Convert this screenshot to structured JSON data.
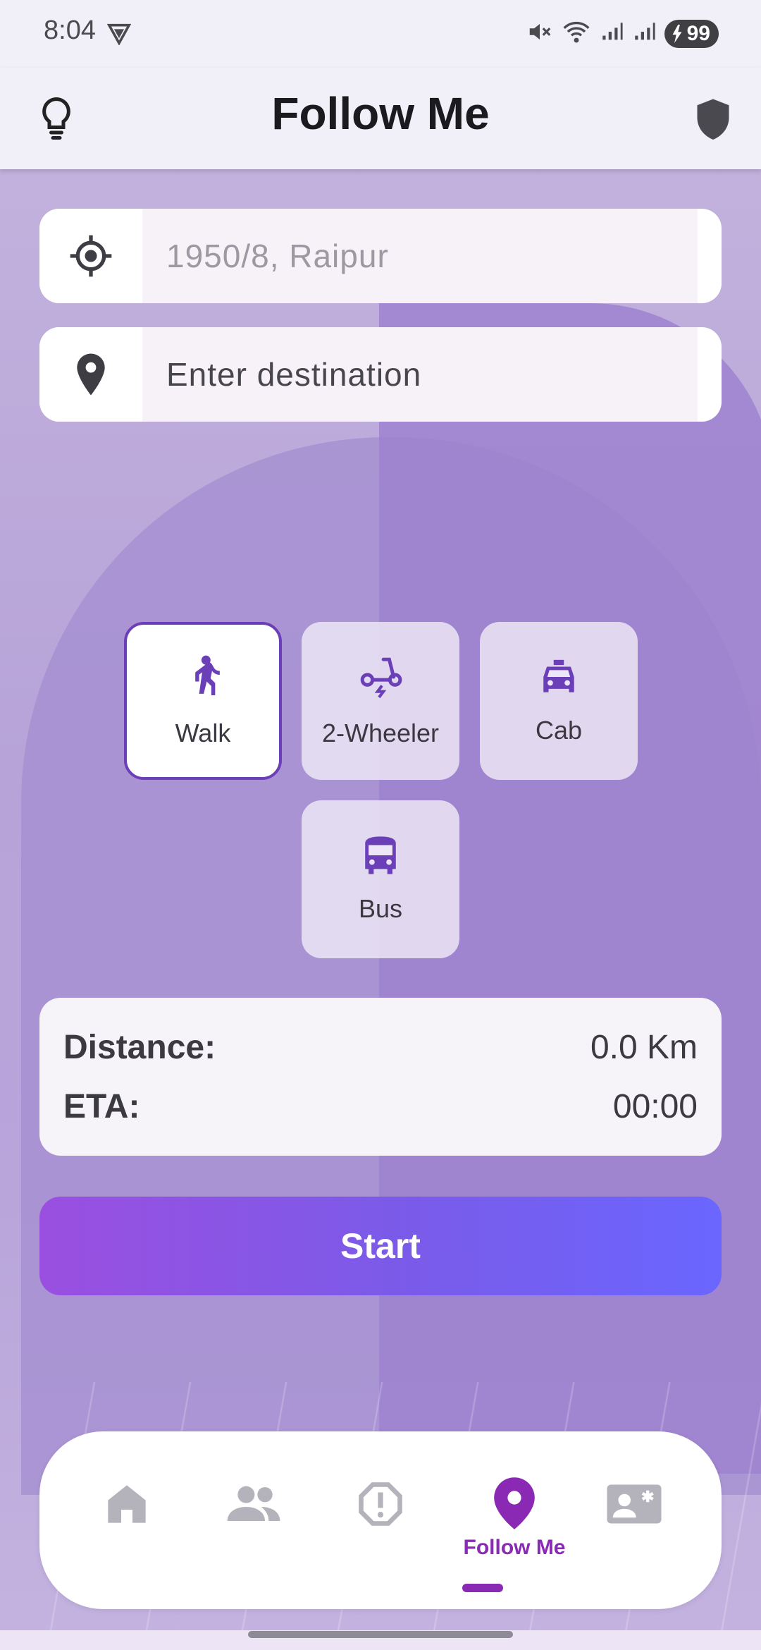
{
  "status_bar": {
    "time": "8:04",
    "battery": "99",
    "icons": [
      "vpn-icon",
      "mute-icon",
      "wifi-icon",
      "signal-icon",
      "signal-icon",
      "battery-icon"
    ]
  },
  "app_bar": {
    "title": "Follow Me",
    "left_icon": "lightbulb-icon",
    "right_icon": "shield-icon"
  },
  "origin": {
    "placeholder": "1950/8, Raipur",
    "icon": "gps-target-icon"
  },
  "destination": {
    "placeholder": "Enter destination",
    "icon": "location-pin-icon"
  },
  "modes": [
    {
      "label": "Walk",
      "icon": "walk-icon",
      "selected": true
    },
    {
      "label": "2-Wheeler",
      "icon": "scooter-icon",
      "selected": false
    },
    {
      "label": "Cab",
      "icon": "taxi-icon",
      "selected": false
    },
    {
      "label": "Bus",
      "icon": "bus-icon",
      "selected": false
    }
  ],
  "stats": {
    "distance_label": "Distance:",
    "distance_value": "0.0 Km",
    "eta_label": "ETA:",
    "eta_value": "00:00"
  },
  "start_button": "Start",
  "colors": {
    "accent": "#8a2ab4",
    "mode_icon": "#6b3fb7",
    "start_gradient": [
      "#9a4fe0",
      "#6a66ff"
    ]
  },
  "bottom_nav": {
    "items": [
      {
        "icon": "home-icon",
        "active": false
      },
      {
        "icon": "people-icon",
        "active": false
      },
      {
        "icon": "alert-octagon-icon",
        "active": false
      },
      {
        "icon": "location-pin-icon",
        "label": "Follow Me",
        "active": true
      },
      {
        "icon": "contact-card-icon",
        "active": false
      }
    ]
  }
}
